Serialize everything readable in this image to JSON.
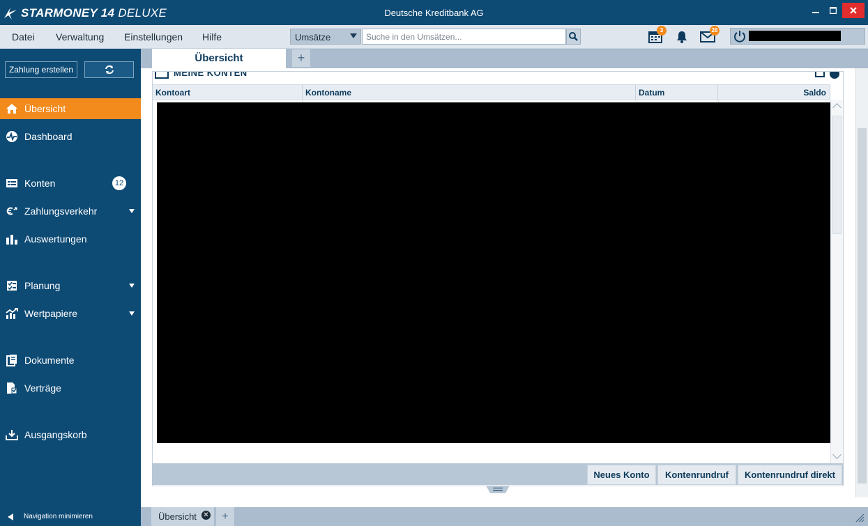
{
  "window": {
    "brand_main": "STARMONEY 14",
    "brand_sub": "DELUXE",
    "title": "Deutsche Kreditbank AG",
    "minimize": "–",
    "maximize": "☐",
    "close": "✕"
  },
  "menu": {
    "items": [
      "Datei",
      "Verwaltung",
      "Einstellungen",
      "Hilfe"
    ]
  },
  "search": {
    "scope": "Umsätze",
    "placeholder": "Suche in den Umsätzen...",
    "value": ""
  },
  "toolbar": {
    "calendar_badge": "3",
    "mail_badge": "26"
  },
  "user": {
    "name": "[redacted]"
  },
  "sidebar": {
    "zahlung_label": "Zahlung erstellen",
    "items": [
      {
        "label": "Übersicht",
        "icon": "home-icon",
        "active": true
      },
      {
        "label": "Dashboard",
        "icon": "dashboard-icon"
      },
      {
        "label": "Konten",
        "icon": "accounts-icon",
        "count": "12"
      },
      {
        "label": "Zahlungsverkehr",
        "icon": "euro-transfer-icon",
        "expandable": true
      },
      {
        "label": "Auswertungen",
        "icon": "bar-chart-icon"
      },
      {
        "label": "Planung",
        "icon": "planning-icon",
        "expandable": true
      },
      {
        "label": "Wertpapiere",
        "icon": "stocks-icon",
        "expandable": true
      },
      {
        "label": "Dokumente",
        "icon": "documents-icon"
      },
      {
        "label": "Verträge",
        "icon": "contracts-icon"
      },
      {
        "label": "Ausgangskorb",
        "icon": "outbox-icon"
      }
    ],
    "minimize_label": "Navigation minimieren"
  },
  "tabs": {
    "main_tab": "Übersicht",
    "add": "+"
  },
  "widget": {
    "title": "MEINE KONTEN",
    "columns": [
      "Kontoart",
      "Kontoname",
      "Datum",
      "Saldo"
    ],
    "rows_redacted": true
  },
  "actions": {
    "new_account": "Neues Konto",
    "fetch": "Kontenrundruf",
    "fetch_direct": "Kontenrundruf direkt"
  },
  "bottom_tabs": {
    "tab": "Übersicht",
    "close": "✕",
    "add": "+"
  },
  "colors": {
    "primary": "#0d4a74",
    "accent": "#f28a1c",
    "close_red": "#e12d2d"
  }
}
